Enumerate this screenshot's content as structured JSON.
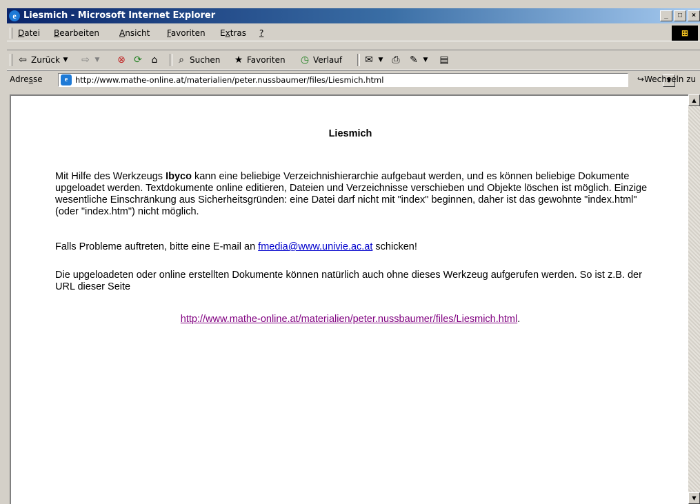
{
  "window": {
    "title": "Liesmich - Microsoft Internet Explorer",
    "controls": [
      "_",
      "□",
      "×"
    ]
  },
  "menu": [
    {
      "key": "D",
      "rest": "atei"
    },
    {
      "key": "B",
      "rest": "earbeiten"
    },
    {
      "key": "A",
      "rest": "nsicht"
    },
    {
      "key": "F",
      "rest": "avoriten"
    },
    {
      "pre": "E",
      "key": "x",
      "rest": "tras"
    },
    {
      "key": "?",
      "rest": ""
    }
  ],
  "toolbar": {
    "back": "Zurück",
    "search": "Suchen",
    "favorites": "Favoriten",
    "history": "Verlauf"
  },
  "address": {
    "label_pre": "Adre",
    "label_key": "s",
    "label_post": "se",
    "url": "http://www.mathe-online.at/materialien/peter.nussbaumer/files/Liesmich.html",
    "go_label": "Wechseln zu"
  },
  "page": {
    "heading": "Liesmich",
    "p1_a": "Mit Hilfe des Werkzeugs ",
    "p1_bold": "Ibyco",
    "p1_b": " kann eine beliebige Verzeichnishierarchie aufgebaut werden, und es können beliebige Dokumente upgeloadet werden. Textdokumente online editieren, Dateien und Verzeichnisse verschieben und Objekte löschen ist möglich. Einzige wesentliche Einschränkung aus Sicherheitsgründen: eine Datei darf nicht mit \"index\" beginnen, daher ist das gewohnte \"index.html\" (oder \"index.htm\") nicht möglich.",
    "p2_a": "Falls Probleme auftreten, bitte eine E-mail an ",
    "p2_link": "fmedia@www.univie.ac.at",
    "p2_b": " schicken!",
    "p3": "Die upgeloadeten oder online erstellten Dokumente können natürlich auch ohne dieses Werkzeug aufgerufen werden. So ist z.B. der URL dieser Seite",
    "url_link": "http://www.mathe-online.at/materialien/peter.nussbaumer/files/Liesmich.html",
    "url_suffix": "."
  }
}
